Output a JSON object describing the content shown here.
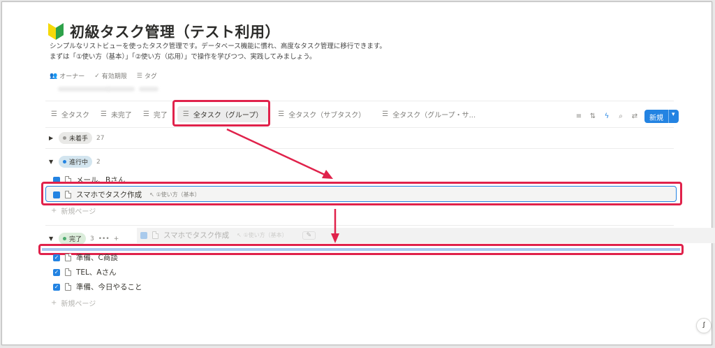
{
  "page": {
    "title": "初級タスク管理（テスト利用）",
    "description_line1": "シンプルなリストビューを使ったタスク管理です。データベース機能に慣れ、高度なタスク管理に移行できます。",
    "description_line2": "まずは「①使い方（基本）」「②使い方（応用）」で操作を学びつつ、実践してみましょう。",
    "properties": [
      {
        "icon": "people-icon",
        "label": "オーナー"
      },
      {
        "icon": "check-circle-icon",
        "label": "有効期限"
      },
      {
        "icon": "list-icon",
        "label": "タグ"
      }
    ]
  },
  "views": {
    "tabs": [
      "全タスク",
      "未完了",
      "完了",
      "全タスク（グループ）",
      "全タスク（サブタスク）",
      "全タスク（グループ・サ..."
    ],
    "active_index": 3,
    "new_button": "新規"
  },
  "groups": {
    "not_started": {
      "label": "未着手",
      "count": "27",
      "dot_color": "#9b9a97",
      "bg": "#e9e9e7"
    },
    "in_progress": {
      "label": "進行中",
      "count": "2",
      "dot_color": "#2383e2",
      "bg": "#d3e5ef",
      "rows": [
        {
          "name": "メール、Bさん",
          "checked": false
        },
        {
          "name": "スマホでタスク作成",
          "checked": false,
          "relation": "①使い方（基本）"
        }
      ],
      "add_label": "新規ページ"
    },
    "done": {
      "label": "完了",
      "count": "3",
      "more": "•••",
      "plus": "+",
      "dot_color": "#4dab6f",
      "bg": "#dbeddb",
      "rows": [
        {
          "name": "準備、C商談",
          "checked": true
        },
        {
          "name": "TEL、Aさん",
          "checked": true
        },
        {
          "name": "準備、今日やること",
          "checked": true
        }
      ],
      "add_label": "新規ページ"
    }
  },
  "drag_ghost": {
    "name": "スマホでタスク作成",
    "relation": "①使い方（基本）"
  },
  "colors": {
    "accent": "#2383e2",
    "highlight_red": "#e0224b"
  }
}
